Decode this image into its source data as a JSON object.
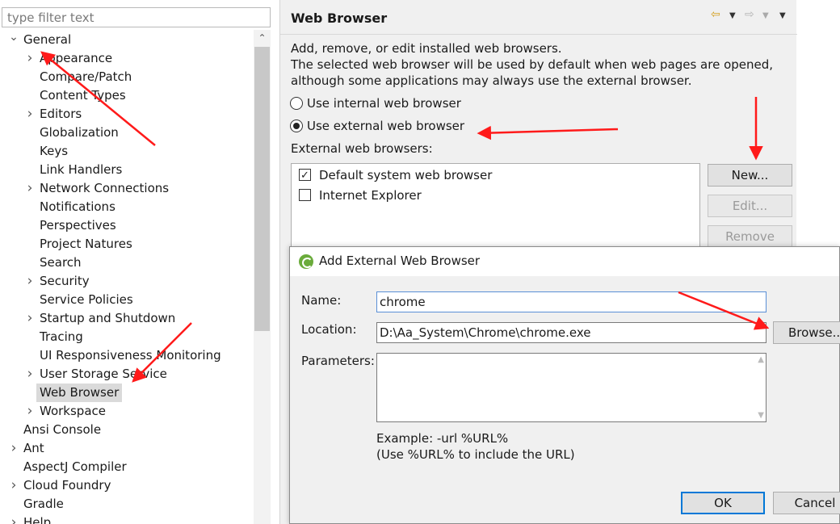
{
  "filter": {
    "placeholder": "type filter text"
  },
  "tree": {
    "items": [
      {
        "label": "General",
        "twisty": "expanded"
      },
      {
        "label": "Appearance",
        "twisty": "collapsed"
      },
      {
        "label": "Compare/Patch",
        "twisty": "none"
      },
      {
        "label": "Content Types",
        "twisty": "none"
      },
      {
        "label": "Editors",
        "twisty": "collapsed"
      },
      {
        "label": "Globalization",
        "twisty": "none"
      },
      {
        "label": "Keys",
        "twisty": "none"
      },
      {
        "label": "Link Handlers",
        "twisty": "none"
      },
      {
        "label": "Network Connections",
        "twisty": "collapsed"
      },
      {
        "label": "Notifications",
        "twisty": "none"
      },
      {
        "label": "Perspectives",
        "twisty": "none"
      },
      {
        "label": "Project Natures",
        "twisty": "none"
      },
      {
        "label": "Search",
        "twisty": "none"
      },
      {
        "label": "Security",
        "twisty": "collapsed"
      },
      {
        "label": "Service Policies",
        "twisty": "none"
      },
      {
        "label": "Startup and Shutdown",
        "twisty": "collapsed"
      },
      {
        "label": "Tracing",
        "twisty": "none"
      },
      {
        "label": "UI Responsiveness Monitoring",
        "twisty": "none"
      },
      {
        "label": "User Storage Service",
        "twisty": "collapsed"
      },
      {
        "label": "Web Browser",
        "twisty": "none",
        "selected": true
      },
      {
        "label": "Workspace",
        "twisty": "collapsed"
      },
      {
        "label": "Ansi Console",
        "twisty": "none"
      },
      {
        "label": "Ant",
        "twisty": "collapsed"
      },
      {
        "label": "AspectJ Compiler",
        "twisty": "none"
      },
      {
        "label": "Cloud Foundry",
        "twisty": "collapsed"
      },
      {
        "label": "Gradle",
        "twisty": "none"
      },
      {
        "label": "Help",
        "twisty": "collapsed"
      }
    ]
  },
  "page": {
    "title": "Web Browser",
    "description": [
      "Add, remove, or edit installed web browsers.",
      "The selected web browser will be used by default when web pages are opened,",
      "although some applications may always use the external browser."
    ],
    "radio_internal": "Use internal web browser",
    "radio_external": "Use external web browser",
    "browsers_label": "External web browsers:",
    "browsers": [
      {
        "name": "Default system web browser",
        "checked": true
      },
      {
        "name": "Internet Explorer",
        "checked": false
      }
    ],
    "buttons": {
      "new": "New...",
      "edit": "Edit...",
      "remove": "Remove"
    },
    "nav_icons": [
      "back-arrow-icon",
      "back-menu-icon",
      "forward-arrow-icon",
      "forward-menu-icon",
      "view-menu-icon"
    ]
  },
  "dialog": {
    "title": "Add External Web Browser",
    "name_label": "Name:",
    "name_value": "chrome",
    "location_label": "Location:",
    "location_value": "D:\\Aa_System\\Chrome\\chrome.exe",
    "parameters_label": "Parameters:",
    "parameters_value": "",
    "browse_button": "Browse...",
    "example_line1": "Example: -url %URL%",
    "example_line2": "(Use %URL% to include the URL)",
    "ok_button": "OK",
    "cancel_button": "Cancel"
  },
  "colors": {
    "annotation": "#ff1a1a",
    "selection": "#dadada",
    "focus": "#0078d7"
  }
}
